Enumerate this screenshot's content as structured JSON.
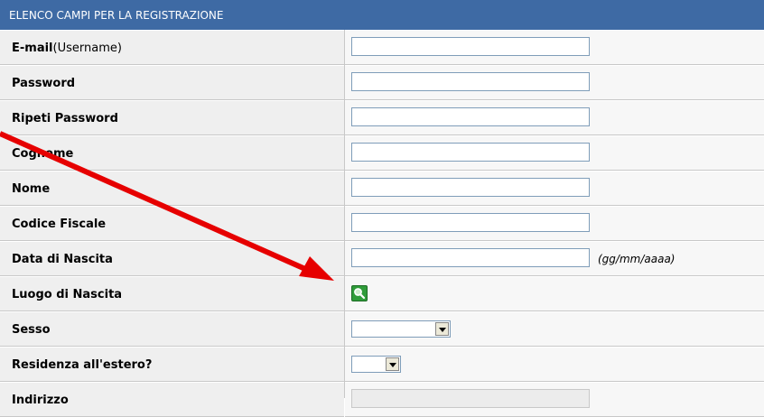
{
  "header": {
    "title": "ELENCO CAMPI PER LA REGISTRAZIONE"
  },
  "fields": {
    "email": {
      "label_bold": "E-mail",
      "label_plain": "(Username)",
      "value": ""
    },
    "password": {
      "label": "Password",
      "value": ""
    },
    "repeat_password": {
      "label": "Ripeti Password",
      "value": ""
    },
    "surname": {
      "label": "Cognome",
      "value": ""
    },
    "name": {
      "label": "Nome",
      "value": ""
    },
    "fiscal_code": {
      "label": "Codice Fiscale",
      "value": ""
    },
    "birth_date": {
      "label": "Data di Nascita",
      "value": "",
      "hint": "(gg/mm/aaaa)"
    },
    "birth_place": {
      "label": "Luogo di Nascita",
      "icon": "search-icon"
    },
    "sex": {
      "label": "Sesso",
      "selected": ""
    },
    "residence_abroad": {
      "label": "Residenza all'estero?",
      "selected": ""
    },
    "address": {
      "label": "Indirizzo"
    }
  },
  "annotation": {
    "color": "#e60000"
  },
  "colors": {
    "header_bg": "#3e6aa4",
    "label_bg": "#efefef",
    "value_bg": "#f7f7f7"
  }
}
